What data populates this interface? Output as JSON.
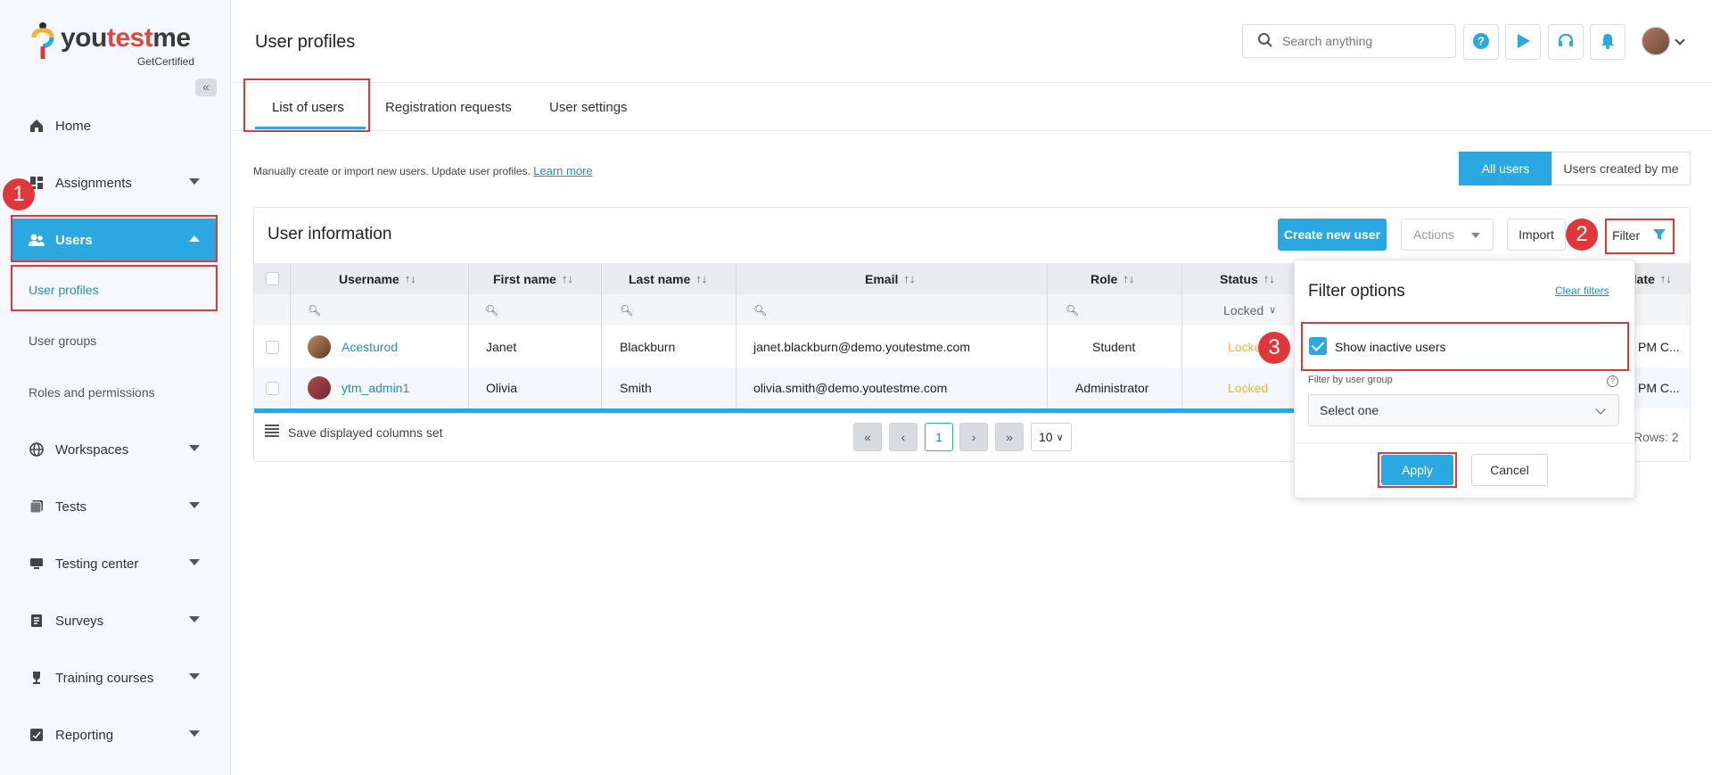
{
  "brand": {
    "name_part1": "you",
    "name_part2": "test",
    "name_part3": "me",
    "tagline": "GetCertified"
  },
  "sidebar": {
    "collapse_label": "«",
    "items": [
      {
        "label": "Home",
        "icon": "home-icon"
      },
      {
        "label": "Assignments",
        "icon": "assignments-icon"
      },
      {
        "label": "Users",
        "icon": "users-icon"
      },
      {
        "label": "Workspaces",
        "icon": "globe-icon"
      },
      {
        "label": "Tests",
        "icon": "tests-icon"
      },
      {
        "label": "Testing center",
        "icon": "monitor-icon"
      },
      {
        "label": "Surveys",
        "icon": "survey-icon"
      },
      {
        "label": "Training courses",
        "icon": "trophy-icon"
      },
      {
        "label": "Reporting",
        "icon": "report-icon"
      }
    ],
    "users_sub": [
      "User profiles",
      "User groups",
      "Roles and permissions"
    ]
  },
  "header": {
    "title": "User profiles",
    "search_placeholder": "Search anything"
  },
  "tabs": [
    "List of users",
    "Registration requests",
    "User settings"
  ],
  "description": "Manually create or import new users. Update user profiles.",
  "learn_more": "Learn more",
  "view_toggle": {
    "all_users": "All users",
    "created_by_me": "Users created by me"
  },
  "card": {
    "title": "User information",
    "create_btn": "Create new user",
    "actions_btn": "Actions",
    "import_btn": "Import",
    "filter_btn": "Filter"
  },
  "table": {
    "columns": [
      "Username",
      "First name",
      "Last name",
      "Email",
      "Role",
      "Status",
      "date"
    ],
    "status_filter": "Locked",
    "rows": [
      {
        "username": "Acesturod",
        "first": "Janet",
        "last": "Blackburn",
        "email": "janet.blackburn@demo.youtestme.com",
        "role": "Student",
        "status": "Locke",
        "date": "PM C..."
      },
      {
        "username": "ytm_admin1",
        "first": "Olivia",
        "last": "Smith",
        "email": "olivia.smith@demo.youtestme.com",
        "role": "Administrator",
        "status": "Locked",
        "date": "PM C..."
      }
    ],
    "save_columns": "Save displayed columns set",
    "page": "1",
    "page_size": "10",
    "rows_count": "Rows: 2"
  },
  "filter_popup": {
    "title": "Filter options",
    "clear": "Clear filters",
    "show_inactive": "Show inactive users",
    "group_label": "Filter by user group",
    "group_value": "Select one",
    "apply": "Apply",
    "cancel": "Cancel"
  },
  "badges": [
    "1",
    "2",
    "3"
  ],
  "colors": {
    "accent": "#2ca8e0",
    "highlight": "#e0383a",
    "locked": "#f2b233"
  }
}
